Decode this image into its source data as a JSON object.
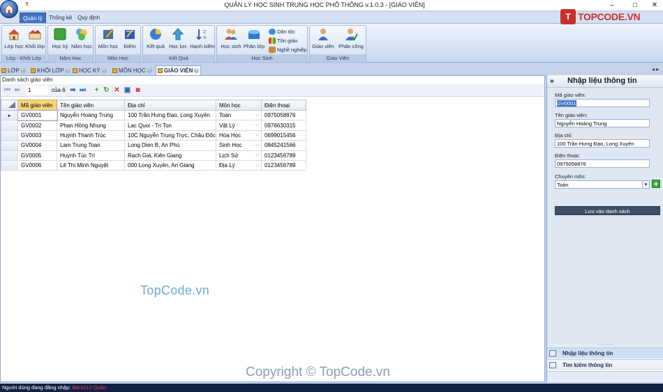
{
  "window": {
    "title": "QUẢN LÝ HỌC SINH TRUNG HỌC PHỔ THÔNG v.1.0.3 - [GIÁO VIÊN]",
    "controls": [
      "–",
      "□",
      "✕"
    ],
    "qat_symbol": "₹"
  },
  "brand": {
    "logo_text": "TOPCODE.VN",
    "logo_mark": "T"
  },
  "ribbon_tabs": [
    "Quản lý",
    "Thống kê",
    "Quy định"
  ],
  "ribbon_groups": [
    {
      "caption": "Lớp - Khối Lớp",
      "buttons": [
        "Lớp học",
        "Khối lớp"
      ]
    },
    {
      "caption": "Năm Học",
      "buttons": [
        "Học kỳ",
        "Năm học"
      ]
    },
    {
      "caption": "Môn Học",
      "buttons": [
        "Môn học",
        "Điểm"
      ]
    },
    {
      "caption": "Kết Quả",
      "buttons": [
        "Kết quả",
        "Học lực",
        "Hạnh kiểm"
      ]
    },
    {
      "caption": "Học Sinh",
      "buttons": [
        "Học sinh",
        "Phân lớp"
      ],
      "small_buttons": [
        "Dân tộc",
        "Tôn giáo",
        "Nghề nghiệp"
      ]
    },
    {
      "caption": "Giáo Viên",
      "buttons": [
        "Giáo viên",
        "Phân công"
      ]
    }
  ],
  "doc_tabs": [
    "LỚP",
    "KHỐI LỚP",
    "HỌC KỲ",
    "MÔN HỌC",
    "GIÁO VIÊN"
  ],
  "list_panel": {
    "title": "Danh sách giáo viên",
    "page_value": "1",
    "page_of": "của 6"
  },
  "grid": {
    "columns": [
      "Mã giáo viên",
      "Tên giáo viên",
      "Địa chỉ",
      "Môn học",
      "Điện thoại"
    ],
    "rows": [
      [
        "GV0001",
        "Nguyễn Hoàng Trung",
        "100 Trần Hưng Đạo, Long Xuyên",
        "Toán",
        "0975058876"
      ],
      [
        "GV0002",
        "Phan Hồng Nhung",
        "Lac Quoi - Tri Ton",
        "Vật Lý",
        "0976630315"
      ],
      [
        "GV0003",
        "Huỳnh Thanh Trúc",
        "10C Nguyễn Trung Trực, Châu Đốc",
        "Hóa Học",
        "0699015456"
      ],
      [
        "GV0004",
        "Lam Trung Toan",
        "Long Dien B, An Phú",
        "Sinh Học",
        "0845241566"
      ],
      [
        "GV0005",
        "Huynh Túc Trí",
        "Rạch Giá, Kiên Giang",
        "Lịch Sử",
        "0123456789"
      ],
      [
        "GV0006",
        "Lê Thi Minh Nguyệt",
        "000 Long Xuyên, An Giang",
        "Địa Lý",
        "0123456789"
      ]
    ]
  },
  "watermarks": [
    "TopCode.vn",
    "Copyright © TopCode.vn"
  ],
  "form": {
    "title": "Nhập liệu thông tin",
    "collapse": "»",
    "ma_label": "Mã giáo viên:",
    "ma_value": "GV0001",
    "ten_label": "Tên giáo viên:",
    "ten_value": "Nguyễn Hoàng Trung",
    "diachi_label": "Địa chỉ:",
    "diachi_value": "100 Trần Hưng Đạo, Long Xuyên",
    "dienthoai_label": "Điện thoại:",
    "dienthoai_value": "0975058876",
    "chuyenmon_label": "Chuyên môn:",
    "chuyenmon_value": "Toán",
    "save_label": "Lưu vào danh sách",
    "nav": [
      "Nhập liệu thông tin",
      "Tìm kiếm thông tin"
    ]
  },
  "status": {
    "label": "Người dùng đang đăng nhập:",
    "user": "tblc2010 Quân"
  },
  "colors": {
    "accent": "#3e73c4",
    "header_selected": "#f7d47c",
    "status_bg": "#102042",
    "brand_red": "#c9302c"
  }
}
